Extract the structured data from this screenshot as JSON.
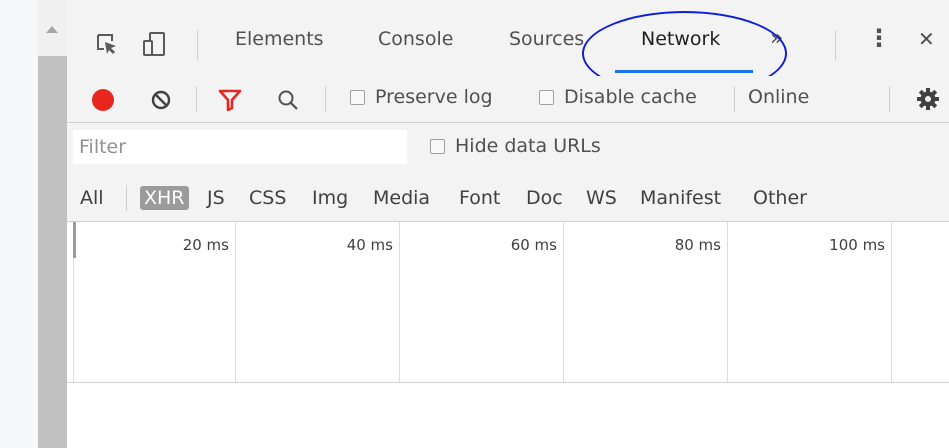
{
  "devtools": {
    "tabs": [
      {
        "label": "Elements"
      },
      {
        "label": "Console"
      },
      {
        "label": "Sources"
      },
      {
        "label": "Network",
        "active": true
      }
    ],
    "more_tabs_glyph": "»",
    "kebab_glyph": "⋮",
    "close_glyph": "✕",
    "accent_color": "#1a73e8",
    "annotation_color": "#0d1fd6"
  },
  "toolbar": {
    "record_color": "#e7261d",
    "preserve_log": "Preserve log",
    "disable_cache": "Disable cache",
    "throttling": "Online"
  },
  "filter": {
    "placeholder": "Filter",
    "value": "",
    "hide_data_urls": "Hide data URLs"
  },
  "types": {
    "items": [
      "All",
      "XHR",
      "JS",
      "CSS",
      "Img",
      "Media",
      "Font",
      "Doc",
      "WS",
      "Manifest",
      "Other"
    ],
    "selected": "XHR"
  },
  "timeline": {
    "ticks": [
      "20 ms",
      "40 ms",
      "60 ms",
      "80 ms",
      "100 ms"
    ]
  }
}
